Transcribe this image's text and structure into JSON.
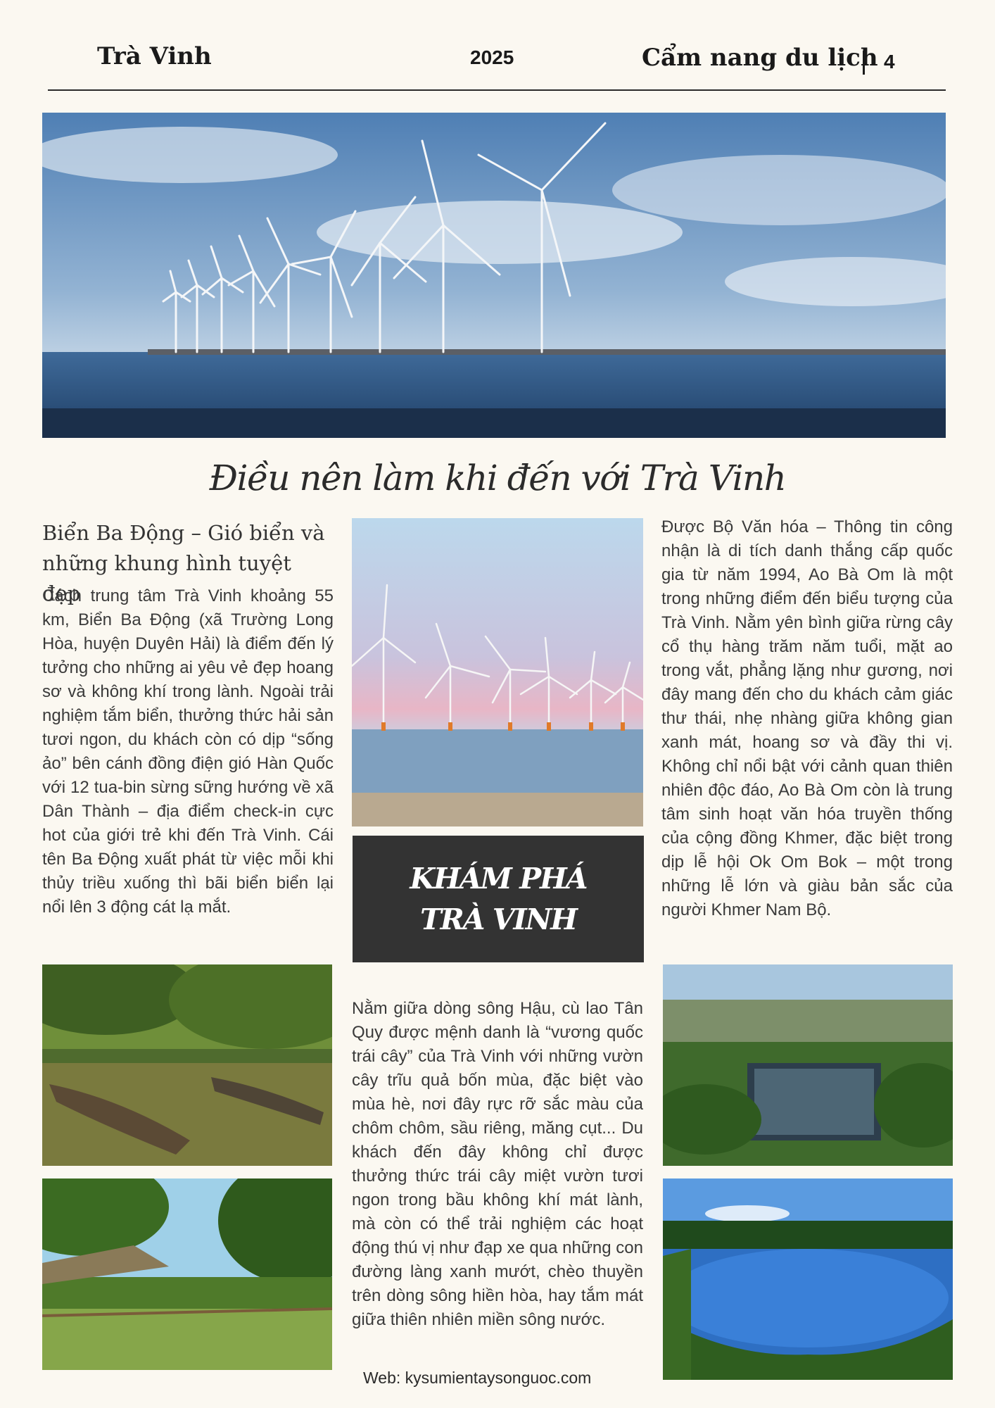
{
  "header": {
    "left_title": "Trà Vinh",
    "year": "2025",
    "guide_title": "Cẩm nang du lịch",
    "page_number": "4"
  },
  "images": {
    "hero": "wind-turbines-sea-photo",
    "mid_top": "wind-turbines-sunset-photo",
    "left_1": "mangrove-boats-photo",
    "left_2": "bamboo-bridge-river-photo",
    "right_1": "ao-ba-om-aerial-photo",
    "right_2": "ao-ba-om-lake-photo"
  },
  "main_title": "Điều nên làm khi đến với Trà Vinh",
  "left_column": {
    "heading": "Biển Ba Động – Gió biển và những khung hình tuyệt đẹp",
    "text": "Cách trung tâm Trà Vinh khoảng 55 km, Biển Ba Động (xã Trường Long Hòa, huyện Duyên Hải) là điểm đến lý tưởng cho những ai yêu vẻ đẹp hoang sơ và không khí trong lành. Ngoài trải nghiệm tắm biển, thưởng thức hải sản tươi ngon, du khách còn có dịp “sống ảo” bên cánh đồng điện gió Hàn Quốc với 12 tua-bin sừng sững hướng về xã Dân Thành – địa điểm check-in cực hot của giới trẻ khi đến Trà Vinh. Cái tên Ba Động xuất phát từ việc mỗi khi thủy triều xuống thì bãi biển biển lại nổi lên 3 động cát lạ mắt."
  },
  "middle_column": {
    "box_line1": "KHÁM PHÁ",
    "box_line2": "TRÀ VINH",
    "text": "Nằm giữa dòng sông Hậu, cù lao Tân Quy được mệnh danh là “vương quốc trái cây” của Trà Vinh với những vườn cây trĩu quả bốn mùa, đặc biệt vào mùa hè, nơi đây rực rỡ sắc màu của chôm chôm, sầu riêng, măng cụt... Du khách đến đây không chỉ được thưởng thức trái cây miệt vườn tươi ngon trong bầu không khí mát lành, mà còn có thể trải nghiệm các hoạt động thú vị như đạp xe qua những con đường làng xanh mướt, chèo thuyền trên dòng sông hiền hòa, hay tắm mát giữa thiên nhiên miền sông nước."
  },
  "right_column": {
    "text": "Được Bộ Văn hóa – Thông tin công nhận là di tích danh thắng cấp quốc gia từ năm 1994, Ao Bà Om là một trong những điểm đến biểu tượng của Trà Vinh. Nằm yên bình giữa rừng cây cổ thụ hàng trăm năm tuổi, mặt ao trong vắt, phẳng lặng như gương, nơi đây mang đến cho du khách cảm giác thư thái, nhẹ nhàng giữa không gian xanh mát, hoang sơ và đầy thi vị. Không chỉ nổi bật với cảnh quan thiên nhiên độc đáo, Ao Bà Om còn là trung tâm sinh hoạt văn hóa truyền thống của cộng đồng Khmer, đặc biệt trong dịp lễ hội Ok Om Bok – một trong những lễ lớn và giàu bản sắc của người Khmer Nam Bộ."
  },
  "footer": {
    "web": "Web: kysumientaysonguoc.com"
  }
}
